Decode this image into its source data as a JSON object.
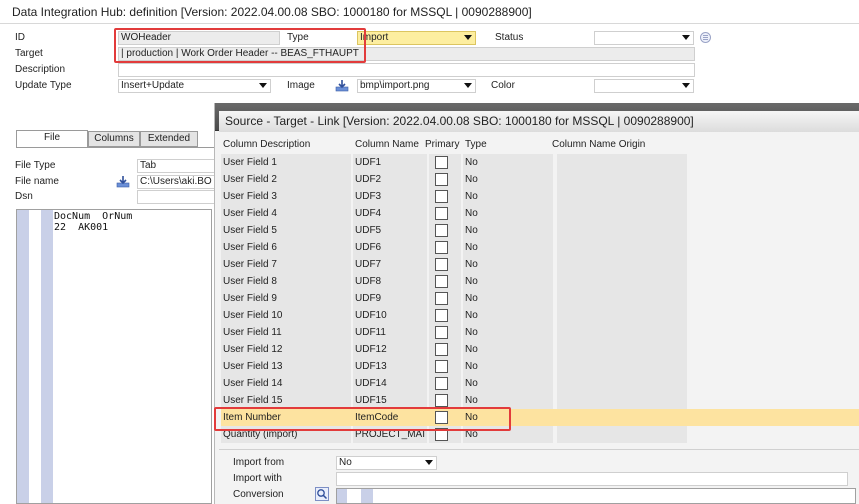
{
  "window": {
    "title": "Data Integration Hub: definition [Version: 2022.04.00.08 SBO: 1000180 for MSSQL | 0090288900]"
  },
  "header": {
    "id_label": "ID",
    "id_value": "WOHeader",
    "type_label": "Type",
    "type_value": "Import",
    "status_label": "Status",
    "status_value": "",
    "target_label": "Target",
    "target_value": "| production | Work Order Header -- BEAS_FTHAUPT",
    "description_label": "Description",
    "description_value": "",
    "update_type_label": "Update Type",
    "update_type_value": "Insert+Update",
    "image_label": "Image",
    "image_value": "bmp\\import.png",
    "color_label": "Color",
    "color_value": ""
  },
  "left_panel": {
    "tabs": [
      {
        "label": "File"
      },
      {
        "label": "Columns"
      },
      {
        "label": "Extended"
      }
    ],
    "file_type_label": "File Type",
    "file_type_value": "Tab",
    "file_name_label": "File name",
    "file_name_value": "C:\\Users\\aki.BO",
    "dsn_label": "Dsn",
    "dsn_value": "",
    "file_content": "DocNum  OrNum\n22  AK001"
  },
  "link_panel": {
    "title": "Source - Target - Link [Version: 2022.04.00.08 SBO: 1000180 for MSSQL | 0090288900]",
    "columns": [
      "Column Description",
      "Column Name",
      "Primary",
      "Type",
      "Column Name Origin"
    ],
    "rows": [
      {
        "desc": "User Field 1",
        "name": "UDF1",
        "type": "No"
      },
      {
        "desc": "User Field 2",
        "name": "UDF2",
        "type": "No"
      },
      {
        "desc": "User Field 3",
        "name": "UDF3",
        "type": "No"
      },
      {
        "desc": "User Field 4",
        "name": "UDF4",
        "type": "No"
      },
      {
        "desc": "User Field 5",
        "name": "UDF5",
        "type": "No"
      },
      {
        "desc": "User Field 6",
        "name": "UDF6",
        "type": "No"
      },
      {
        "desc": "User Field 7",
        "name": "UDF7",
        "type": "No"
      },
      {
        "desc": "User Field 8",
        "name": "UDF8",
        "type": "No"
      },
      {
        "desc": "User Field 9",
        "name": "UDF9",
        "type": "No"
      },
      {
        "desc": "User Field 10",
        "name": "UDF10",
        "type": "No"
      },
      {
        "desc": "User Field 11",
        "name": "UDF11",
        "type": "No"
      },
      {
        "desc": "User Field 12",
        "name": "UDF12",
        "type": "No"
      },
      {
        "desc": "User Field 13",
        "name": "UDF13",
        "type": "No"
      },
      {
        "desc": "User Field 14",
        "name": "UDF14",
        "type": "No"
      },
      {
        "desc": "User Field 15",
        "name": "UDF15",
        "type": "No"
      },
      {
        "desc": "Item Number",
        "name": "ItemCode",
        "type": "No"
      },
      {
        "desc": "Quantity (import)",
        "name": "PROJECT_MAI",
        "type": "No"
      }
    ],
    "import_from_label": "Import from",
    "import_from_value": "No",
    "import_with_label": "Import with",
    "import_with_value": "",
    "conversion_label": "Conversion"
  },
  "colors": {
    "highlight_border": "#e23b3b",
    "highlight_row": "#fde3a0",
    "import_field": "#fdeea0",
    "gutter": "#c9d0e8"
  }
}
